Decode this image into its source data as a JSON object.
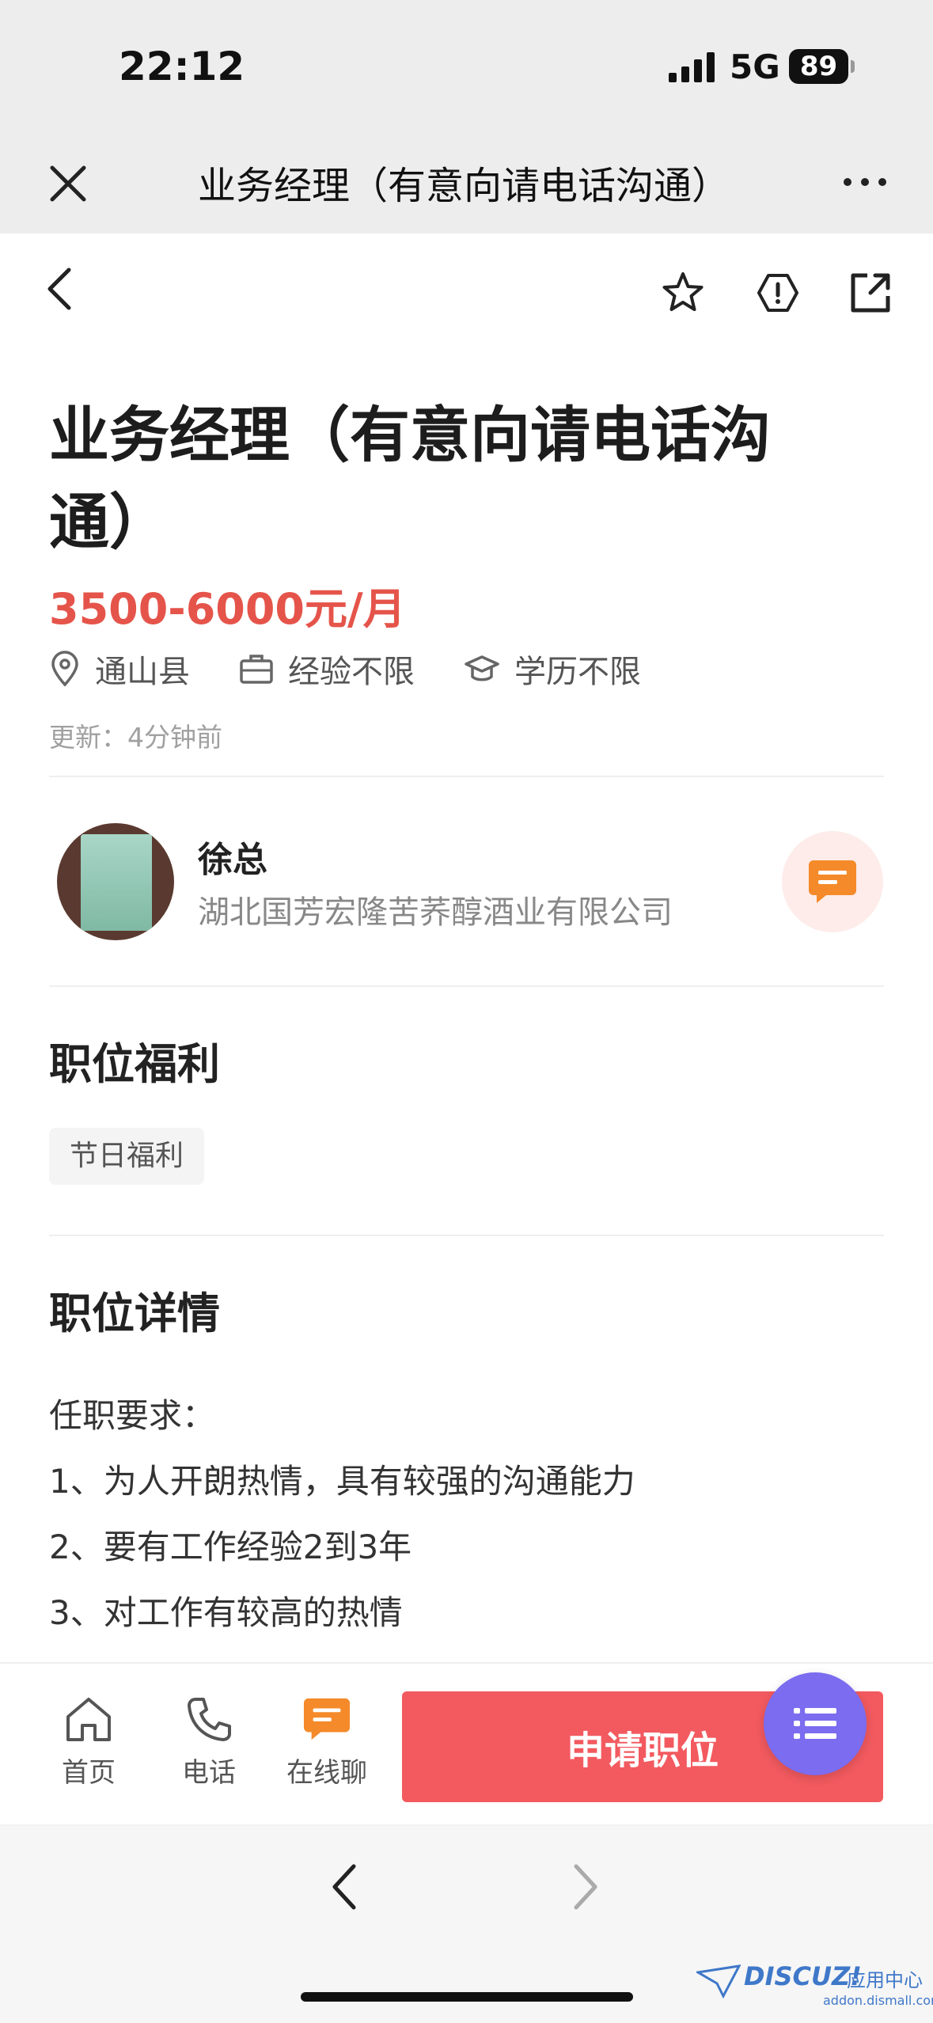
{
  "status_bar": {
    "time": "22:12",
    "network": "5G",
    "battery": "89"
  },
  "nav": {
    "title": "业务经理（有意向请电话沟通）"
  },
  "job": {
    "title": "业务经理（有意向请电话沟通）",
    "salary": "3500-6000元/月",
    "location": "通山县",
    "experience": "经验不限",
    "education": "学历不限",
    "updated": "更新：4分钟前"
  },
  "recruiter": {
    "name": "徐总",
    "company": "湖北国芳宏隆苦荞醇酒业有限公司"
  },
  "benefits": {
    "heading": "职位福利",
    "items": [
      "节日福利"
    ]
  },
  "details": {
    "heading": "职位详情",
    "lines": [
      "任职要求：",
      "1、为人开朗热情，具有较强的沟通能力",
      "2、要有工作经验2到3年",
      "3、对工作有较高的热情"
    ]
  },
  "actions": {
    "home": "首页",
    "phone": "电话",
    "chat": "在线聊",
    "apply": "申请职位"
  },
  "watermark": {
    "brand": "DISCUZ!",
    "cn": "应用中心",
    "url": "addon.dismall.com"
  },
  "colors": {
    "accent": "#f25a5f",
    "salary": "#e5544a",
    "chat": "#f58a2a",
    "fab": "#7b6cf0"
  }
}
